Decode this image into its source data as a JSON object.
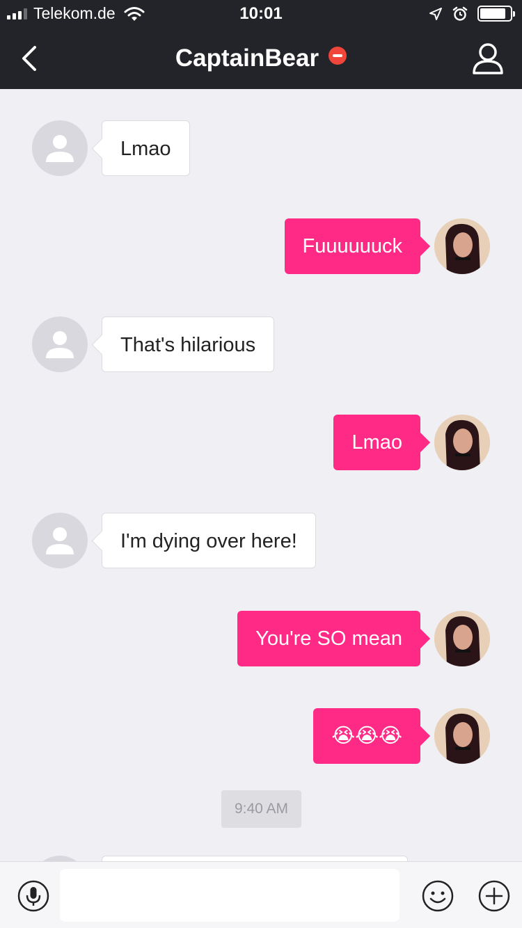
{
  "status_bar": {
    "carrier": "Telekom.de",
    "time": "10:01",
    "icons": [
      "signal-icon",
      "wifi-icon",
      "location-icon",
      "alarm-icon",
      "battery-icon"
    ],
    "battery_level": 0.85
  },
  "header": {
    "title": "CaptainBear",
    "status_icon": "blocked-icon",
    "back_icon": "chevron-left-icon",
    "profile_icon": "user-icon"
  },
  "messages": [
    {
      "sender": "peer",
      "text": "Lmao"
    },
    {
      "sender": "me",
      "text": "Fuuuuuuck"
    },
    {
      "sender": "peer",
      "text": "That's hilarious"
    },
    {
      "sender": "me",
      "text": "Lmao"
    },
    {
      "sender": "peer",
      "text": "I'm dying over here!"
    },
    {
      "sender": "me",
      "text": "You're SO mean"
    },
    {
      "sender": "me",
      "text": "😭😭😭"
    }
  ],
  "timestamp": "9:40 AM",
  "input_bar": {
    "placeholder": "",
    "icons": [
      "microphone-icon",
      "emoji-icon",
      "plus-icon"
    ]
  },
  "colors": {
    "header_bg": "#23232a",
    "outgoing_bubble": "#ff2a85",
    "incoming_bubble": "#ffffff",
    "chat_bg": "#efeff4",
    "blocked_badge": "#f0453a"
  }
}
